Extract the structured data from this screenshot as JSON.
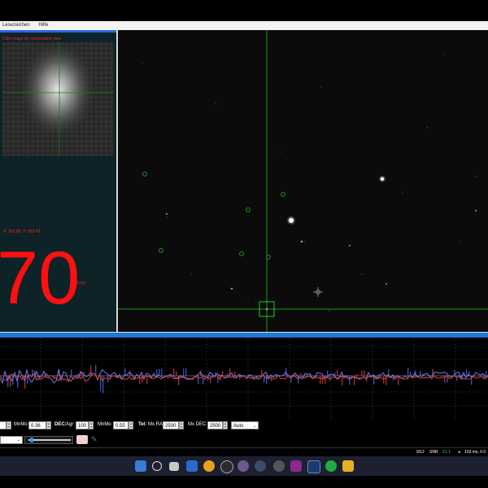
{
  "menu": {
    "items": [
      "Lesezeichen",
      "Hilfe"
    ]
  },
  "star_panel": {
    "hint": "Click image for interpolated view",
    "coords": "X: 202.85, Y: 303.43",
    "big_value": "70",
    "small_value": "3.70\""
  },
  "controls": {
    "field1": "",
    "mnmo1_label": "MnMo",
    "mnmo1_value": "0.36",
    "dec_label": "DEC:",
    "agr_label": "Agr",
    "agr_value": "100",
    "mnmo2_label": "MnMo",
    "mnmo2_value": "0.55",
    "tel_label": "Tel:",
    "mxra_label": "Mx RA",
    "mxra_value": "2500",
    "mxdec_label": "Mx DEC",
    "mxdec_value": "2500",
    "auto_value": "Auto"
  },
  "status": {
    "frame": "9/12",
    "snr_label": "SNR",
    "snr_value": "21.1",
    "exposure": "103 ms, 0.0"
  },
  "colors": {
    "accent": "#1e7ad8",
    "panel": "#0d2327",
    "readout": "#ff1010",
    "crosshair": "#22cc22"
  },
  "graph": {
    "ra_color": "#4a6ae8",
    "dec_color": "#e03a3a"
  },
  "taskbar_icons": [
    "start-icon",
    "search-icon",
    "task-view-icon",
    "widgets-icon",
    "edge-icon",
    "chrome-icon",
    "stellarium-icon",
    "sky-icon",
    "nina-icon",
    "app-icon",
    "lightroom-icon",
    "phd2-icon",
    "file-explorer-icon"
  ]
}
